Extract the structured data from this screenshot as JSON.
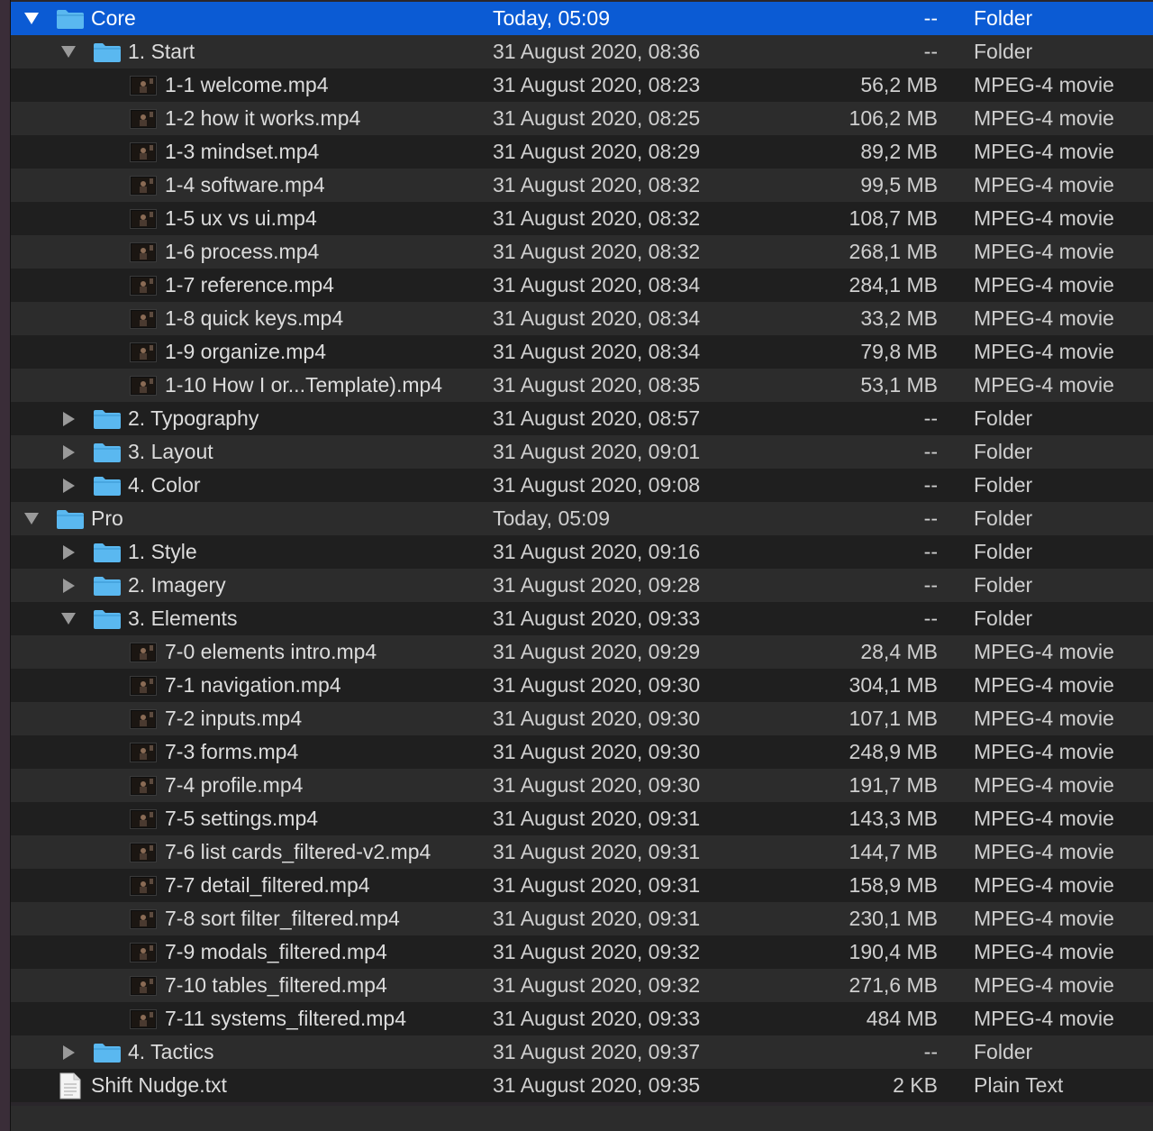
{
  "colors": {
    "selection": "#0b5bd4",
    "folder": "#5ab8f0",
    "row_dark": "#1f1f1f",
    "row_light": "#2c2c2c",
    "text": "#dcdcdc"
  },
  "rows": [
    {
      "name": "Core",
      "date": "Today, 05:09",
      "size": "--",
      "kind": "Folder",
      "type": "folder",
      "depth": 0,
      "expanded": true,
      "selected": true
    },
    {
      "name": "1. Start",
      "date": "31 August 2020, 08:36",
      "size": "--",
      "kind": "Folder",
      "type": "folder",
      "depth": 1,
      "expanded": true
    },
    {
      "name": "1-1 welcome.mp4",
      "date": "31 August 2020, 08:23",
      "size": "56,2 MB",
      "kind": "MPEG-4 movie",
      "type": "movie",
      "depth": 2
    },
    {
      "name": "1-2 how it works.mp4",
      "date": "31 August 2020, 08:25",
      "size": "106,2 MB",
      "kind": "MPEG-4 movie",
      "type": "movie",
      "depth": 2
    },
    {
      "name": "1-3 mindset.mp4",
      "date": "31 August 2020, 08:29",
      "size": "89,2 MB",
      "kind": "MPEG-4 movie",
      "type": "movie",
      "depth": 2
    },
    {
      "name": "1-4 software.mp4",
      "date": "31 August 2020, 08:32",
      "size": "99,5 MB",
      "kind": "MPEG-4 movie",
      "type": "movie",
      "depth": 2
    },
    {
      "name": "1-5 ux vs ui.mp4",
      "date": "31 August 2020, 08:32",
      "size": "108,7 MB",
      "kind": "MPEG-4 movie",
      "type": "movie",
      "depth": 2
    },
    {
      "name": "1-6 process.mp4",
      "date": "31 August 2020, 08:32",
      "size": "268,1 MB",
      "kind": "MPEG-4 movie",
      "type": "movie",
      "depth": 2
    },
    {
      "name": "1-7 reference.mp4",
      "date": "31 August 2020, 08:34",
      "size": "284,1 MB",
      "kind": "MPEG-4 movie",
      "type": "movie",
      "depth": 2
    },
    {
      "name": "1-8 quick keys.mp4",
      "date": "31 August 2020, 08:34",
      "size": "33,2 MB",
      "kind": "MPEG-4 movie",
      "type": "movie",
      "depth": 2
    },
    {
      "name": "1-9 organize.mp4",
      "date": "31 August 2020, 08:34",
      "size": "79,8 MB",
      "kind": "MPEG-4 movie",
      "type": "movie",
      "depth": 2
    },
    {
      "name": "1-10 How I or...Template).mp4",
      "date": "31 August 2020, 08:35",
      "size": "53,1 MB",
      "kind": "MPEG-4 movie",
      "type": "movie",
      "depth": 2
    },
    {
      "name": "2. Typography",
      "date": "31 August 2020, 08:57",
      "size": "--",
      "kind": "Folder",
      "type": "folder",
      "depth": 1,
      "expanded": false
    },
    {
      "name": "3. Layout",
      "date": "31 August 2020, 09:01",
      "size": "--",
      "kind": "Folder",
      "type": "folder",
      "depth": 1,
      "expanded": false
    },
    {
      "name": "4. Color",
      "date": "31 August 2020, 09:08",
      "size": "--",
      "kind": "Folder",
      "type": "folder",
      "depth": 1,
      "expanded": false
    },
    {
      "name": "Pro",
      "date": "Today, 05:09",
      "size": "--",
      "kind": "Folder",
      "type": "folder",
      "depth": 0,
      "expanded": true
    },
    {
      "name": "1. Style",
      "date": "31 August 2020, 09:16",
      "size": "--",
      "kind": "Folder",
      "type": "folder",
      "depth": 1,
      "expanded": false
    },
    {
      "name": "2. Imagery",
      "date": "31 August 2020, 09:28",
      "size": "--",
      "kind": "Folder",
      "type": "folder",
      "depth": 1,
      "expanded": false
    },
    {
      "name": "3. Elements",
      "date": "31 August 2020, 09:33",
      "size": "--",
      "kind": "Folder",
      "type": "folder",
      "depth": 1,
      "expanded": true
    },
    {
      "name": "7-0 elements intro.mp4",
      "date": "31 August 2020, 09:29",
      "size": "28,4 MB",
      "kind": "MPEG-4 movie",
      "type": "movie",
      "depth": 2
    },
    {
      "name": "7-1 navigation.mp4",
      "date": "31 August 2020, 09:30",
      "size": "304,1 MB",
      "kind": "MPEG-4 movie",
      "type": "movie",
      "depth": 2
    },
    {
      "name": "7-2 inputs.mp4",
      "date": "31 August 2020, 09:30",
      "size": "107,1 MB",
      "kind": "MPEG-4 movie",
      "type": "movie",
      "depth": 2
    },
    {
      "name": "7-3 forms.mp4",
      "date": "31 August 2020, 09:30",
      "size": "248,9 MB",
      "kind": "MPEG-4 movie",
      "type": "movie",
      "depth": 2
    },
    {
      "name": "7-4 profile.mp4",
      "date": "31 August 2020, 09:30",
      "size": "191,7 MB",
      "kind": "MPEG-4 movie",
      "type": "movie",
      "depth": 2
    },
    {
      "name": "7-5 settings.mp4",
      "date": "31 August 2020, 09:31",
      "size": "143,3 MB",
      "kind": "MPEG-4 movie",
      "type": "movie",
      "depth": 2
    },
    {
      "name": "7-6 list cards_filtered-v2.mp4",
      "date": "31 August 2020, 09:31",
      "size": "144,7 MB",
      "kind": "MPEG-4 movie",
      "type": "movie",
      "depth": 2
    },
    {
      "name": "7-7 detail_filtered.mp4",
      "date": "31 August 2020, 09:31",
      "size": "158,9 MB",
      "kind": "MPEG-4 movie",
      "type": "movie",
      "depth": 2
    },
    {
      "name": "7-8 sort filter_filtered.mp4",
      "date": "31 August 2020, 09:31",
      "size": "230,1 MB",
      "kind": "MPEG-4 movie",
      "type": "movie",
      "depth": 2
    },
    {
      "name": "7-9 modals_filtered.mp4",
      "date": "31 August 2020, 09:32",
      "size": "190,4 MB",
      "kind": "MPEG-4 movie",
      "type": "movie",
      "depth": 2
    },
    {
      "name": "7-10 tables_filtered.mp4",
      "date": "31 August 2020, 09:32",
      "size": "271,6 MB",
      "kind": "MPEG-4 movie",
      "type": "movie",
      "depth": 2
    },
    {
      "name": "7-11 systems_filtered.mp4",
      "date": "31 August 2020, 09:33",
      "size": "484 MB",
      "kind": "MPEG-4 movie",
      "type": "movie",
      "depth": 2
    },
    {
      "name": "4. Tactics",
      "date": "31 August 2020, 09:37",
      "size": "--",
      "kind": "Folder",
      "type": "folder",
      "depth": 1,
      "expanded": false
    },
    {
      "name": "Shift Nudge.txt",
      "date": "31 August 2020, 09:35",
      "size": "2 KB",
      "kind": "Plain Text",
      "type": "text",
      "depth": 0
    }
  ]
}
